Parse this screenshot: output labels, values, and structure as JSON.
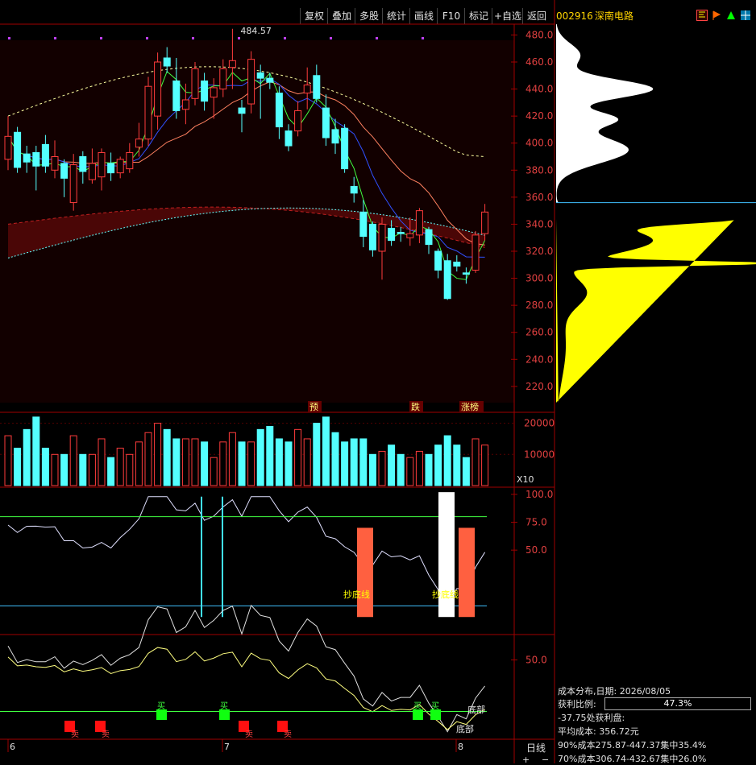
{
  "toolbar": {
    "buttons": [
      "复权",
      "叠加",
      "多股",
      "统计",
      "画线",
      "F10",
      "标记",
      "+自选",
      "返回"
    ]
  },
  "stock": {
    "code": "002916",
    "name": "深南电路"
  },
  "main_chart": {
    "high_label": "484.57",
    "event_labels": [
      "预",
      "跌",
      "涨榜"
    ]
  },
  "volume_panel": {
    "unit_label": "X10"
  },
  "indicator1": {
    "labels": [
      "抄底线",
      "抄底线"
    ]
  },
  "indicator2": {
    "labels": [
      "卖",
      "卖",
      "卖",
      "卖",
      "买",
      "买",
      "买",
      "买",
      "底部",
      "底部"
    ]
  },
  "x_axis": {
    "labels": [
      "6",
      "7",
      "8"
    ]
  },
  "period_label": "日线",
  "zoom": {
    "plus": "+",
    "minus": "−"
  },
  "chip_info": {
    "title": "成本分布,日期: 2026/08/05",
    "profit_label": "获利比例:",
    "profit_value": "47.3%",
    "profit_fraction": 0.473,
    "profit_at": "-37.75处获利盘:",
    "avg_cost": "平均成本: 356.72元",
    "c90": "90%成本275.87-447.37集中35.4%",
    "c70": "70%成本306.74-432.67集中26.0%"
  },
  "colors": {
    "up": "#ff3c3c",
    "down": "#54ffff",
    "yellow": "#ffff00",
    "bg": "#000000",
    "grid": "#8b0000"
  },
  "chart_data": {
    "type": "candlestick",
    "price_axis": {
      "ticks": [
        220,
        240,
        260,
        280,
        300,
        320,
        340,
        360,
        380,
        400,
        420,
        440,
        460,
        480
      ],
      "ylim": [
        208,
        488
      ]
    },
    "volume_axis": {
      "ticks": [
        10000,
        20000
      ],
      "ylim": [
        0,
        23000
      ]
    },
    "ind1_axis": {
      "ticks": [
        50,
        75,
        100
      ],
      "ylim": [
        -25,
        105
      ]
    },
    "ind2_axis": {
      "ticks": [
        50
      ],
      "ylim": [
        -50,
        80
      ]
    },
    "candles": [
      {
        "o": 388,
        "c": 405,
        "h": 420,
        "l": 380
      },
      {
        "o": 408,
        "c": 382,
        "h": 412,
        "l": 378
      },
      {
        "o": 392,
        "c": 386,
        "h": 398,
        "l": 378
      },
      {
        "o": 393,
        "c": 383,
        "h": 398,
        "l": 365
      },
      {
        "o": 399,
        "c": 383,
        "h": 406,
        "l": 378
      },
      {
        "o": 380,
        "c": 390,
        "h": 402,
        "l": 374
      },
      {
        "o": 385,
        "c": 374,
        "h": 388,
        "l": 360
      },
      {
        "o": 356,
        "c": 384,
        "h": 392,
        "l": 350
      },
      {
        "o": 390,
        "c": 379,
        "h": 394,
        "l": 370
      },
      {
        "o": 373,
        "c": 385,
        "h": 396,
        "l": 370
      },
      {
        "o": 375,
        "c": 393,
        "h": 396,
        "l": 365
      },
      {
        "o": 385,
        "c": 378,
        "h": 393,
        "l": 372
      },
      {
        "o": 378,
        "c": 388,
        "h": 390,
        "l": 374
      },
      {
        "o": 381,
        "c": 393,
        "h": 400,
        "l": 378
      },
      {
        "o": 397,
        "c": 403,
        "h": 415,
        "l": 390
      },
      {
        "o": 403,
        "c": 442,
        "h": 449,
        "l": 398
      },
      {
        "o": 420,
        "c": 460,
        "h": 467,
        "l": 410
      },
      {
        "o": 463,
        "c": 457,
        "h": 471,
        "l": 452
      },
      {
        "o": 446,
        "c": 424,
        "h": 463,
        "l": 418
      },
      {
        "o": 425,
        "c": 432,
        "h": 444,
        "l": 414
      },
      {
        "o": 433,
        "c": 455,
        "h": 460,
        "l": 428
      },
      {
        "o": 446,
        "c": 431,
        "h": 452,
        "l": 424
      },
      {
        "o": 434,
        "c": 441,
        "h": 448,
        "l": 418
      },
      {
        "o": 440,
        "c": 455,
        "h": 462,
        "l": 434
      },
      {
        "o": 456,
        "c": 461,
        "h": 484.57,
        "l": 440
      },
      {
        "o": 426,
        "c": 422,
        "h": 432,
        "l": 408
      },
      {
        "o": 429,
        "c": 462,
        "h": 468,
        "l": 422
      },
      {
        "o": 452,
        "c": 448,
        "h": 458,
        "l": 418
      },
      {
        "o": 448,
        "c": 445,
        "h": 452,
        "l": 440
      },
      {
        "o": 437,
        "c": 412,
        "h": 442,
        "l": 403
      },
      {
        "o": 409,
        "c": 398,
        "h": 414,
        "l": 394
      },
      {
        "o": 409,
        "c": 424,
        "h": 431,
        "l": 405
      },
      {
        "o": 437,
        "c": 443,
        "h": 456,
        "l": 425
      },
      {
        "o": 450,
        "c": 433,
        "h": 458,
        "l": 430
      },
      {
        "o": 426,
        "c": 404,
        "h": 436,
        "l": 398
      },
      {
        "o": 410,
        "c": 400,
        "h": 418,
        "l": 392
      },
      {
        "o": 411,
        "c": 381,
        "h": 414,
        "l": 378
      },
      {
        "o": 368,
        "c": 363,
        "h": 375,
        "l": 356
      },
      {
        "o": 349,
        "c": 331,
        "h": 358,
        "l": 323
      },
      {
        "o": 340,
        "c": 321,
        "h": 342,
        "l": 316
      },
      {
        "o": 320,
        "c": 340,
        "h": 345,
        "l": 299
      },
      {
        "o": 337,
        "c": 328,
        "h": 343,
        "l": 324
      },
      {
        "o": 334,
        "c": 333,
        "h": 338,
        "l": 327
      },
      {
        "o": 330,
        "c": 333,
        "h": 345,
        "l": 324
      },
      {
        "o": 332,
        "c": 350,
        "h": 352,
        "l": 326
      },
      {
        "o": 336,
        "c": 325,
        "h": 338,
        "l": 318
      },
      {
        "o": 320,
        "c": 306,
        "h": 322,
        "l": 300
      },
      {
        "o": 313,
        "c": 285,
        "h": 318,
        "l": 284
      },
      {
        "o": 312,
        "c": 309,
        "h": 317,
        "l": 305
      },
      {
        "o": 304,
        "c": 303,
        "h": 308,
        "l": 296
      },
      {
        "o": 306,
        "c": 332,
        "h": 335,
        "l": 304
      },
      {
        "o": 333,
        "c": 349,
        "h": 355,
        "l": 328
      }
    ],
    "volumes": [
      16,
      12,
      18,
      22,
      12,
      10,
      10,
      16,
      10,
      10,
      15,
      9,
      12,
      10,
      14,
      17,
      20,
      18,
      15,
      15,
      15,
      14,
      9,
      14,
      17,
      14,
      14,
      18,
      19,
      15,
      14,
      18,
      15,
      20,
      22,
      17,
      14,
      15,
      15,
      10,
      11,
      13,
      10,
      9,
      11,
      10,
      13,
      16,
      13,
      9,
      15,
      13
    ],
    "chip_distribution": {
      "price_range": [
        208,
        488
      ],
      "current_price": 356
    }
  }
}
